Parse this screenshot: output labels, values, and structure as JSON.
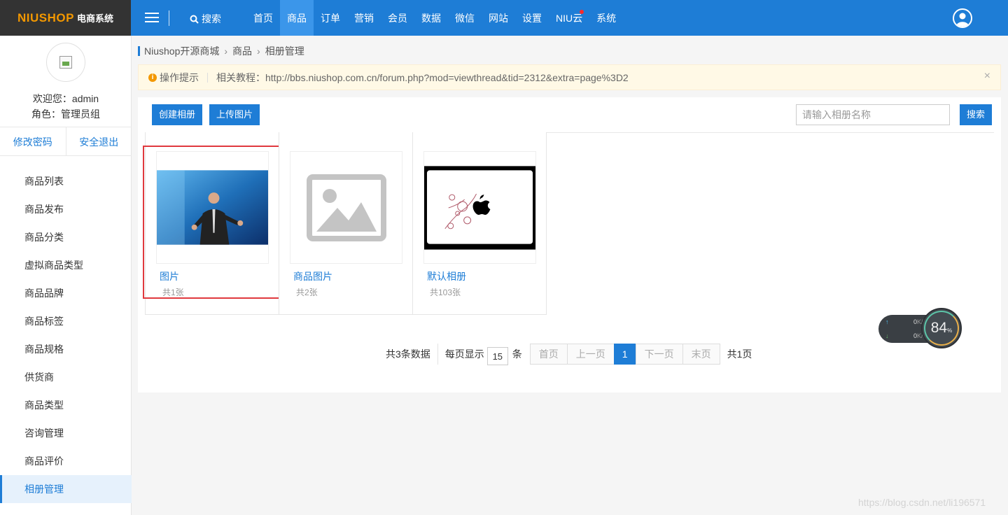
{
  "logo": {
    "brand": "NIUSHOP",
    "suffix": "电商系统"
  },
  "topbar": {
    "search_label": "搜索",
    "nav": [
      {
        "label": "首页",
        "active": false,
        "dot": false
      },
      {
        "label": "商品",
        "active": true,
        "dot": false
      },
      {
        "label": "订单",
        "active": false,
        "dot": false
      },
      {
        "label": "营销",
        "active": false,
        "dot": false
      },
      {
        "label": "会员",
        "active": false,
        "dot": false
      },
      {
        "label": "数据",
        "active": false,
        "dot": false
      },
      {
        "label": "微信",
        "active": false,
        "dot": false
      },
      {
        "label": "网站",
        "active": false,
        "dot": false
      },
      {
        "label": "设置",
        "active": false,
        "dot": false
      },
      {
        "label": "NIU云",
        "active": false,
        "dot": true
      },
      {
        "label": "系统",
        "active": false,
        "dot": false
      }
    ]
  },
  "user": {
    "welcome": "欢迎您：admin",
    "role": "角色：管理员组",
    "change_password": "修改密码",
    "logout": "安全退出"
  },
  "sidebar": {
    "items": [
      {
        "label": "商品列表",
        "active": false
      },
      {
        "label": "商品发布",
        "active": false
      },
      {
        "label": "商品分类",
        "active": false
      },
      {
        "label": "虚拟商品类型",
        "active": false
      },
      {
        "label": "商品品牌",
        "active": false
      },
      {
        "label": "商品标签",
        "active": false
      },
      {
        "label": "商品规格",
        "active": false
      },
      {
        "label": "供货商",
        "active": false
      },
      {
        "label": "商品类型",
        "active": false
      },
      {
        "label": "咨询管理",
        "active": false
      },
      {
        "label": "商品评价",
        "active": false
      },
      {
        "label": "相册管理",
        "active": true
      }
    ]
  },
  "breadcrumb": {
    "items": [
      "Niushop开源商城",
      "商品",
      "相册管理"
    ]
  },
  "tip": {
    "title": "操作提示",
    "text": "相关教程：http://bbs.niushop.com.cn/forum.php?mod=viewthread&tid=2312&extra=page%3D2",
    "close": "×"
  },
  "toolbar": {
    "create_album": "创建相册",
    "upload_image": "上传图片",
    "search_placeholder": "请输入相册名称",
    "search_button": "搜索"
  },
  "albums": [
    {
      "name": "图片",
      "count": "共1张",
      "thumb": "photo"
    },
    {
      "name": "商品图片",
      "count": "共2张",
      "thumb": "placeholder"
    },
    {
      "name": "默认相册",
      "count": "共103张",
      "thumb": "artwork"
    }
  ],
  "pagination": {
    "total": "共3条数据",
    "per_page_label": "每页显示",
    "per_page_value": "15",
    "per_page_unit": "条",
    "first": "首页",
    "prev": "上一页",
    "current": "1",
    "next": "下一页",
    "last": "末页",
    "pages": "共1页"
  },
  "speed_widget": {
    "up": "0",
    "down": "0",
    "unit": "K/s",
    "percent": "84",
    "percent_sign": "%"
  },
  "watermark": "https://blog.csdn.net/li196571",
  "colors": {
    "primary": "#1e7dd6",
    "logo_bg": "#333333",
    "brand_orange": "#f39800",
    "highlight": "#e0393e"
  }
}
